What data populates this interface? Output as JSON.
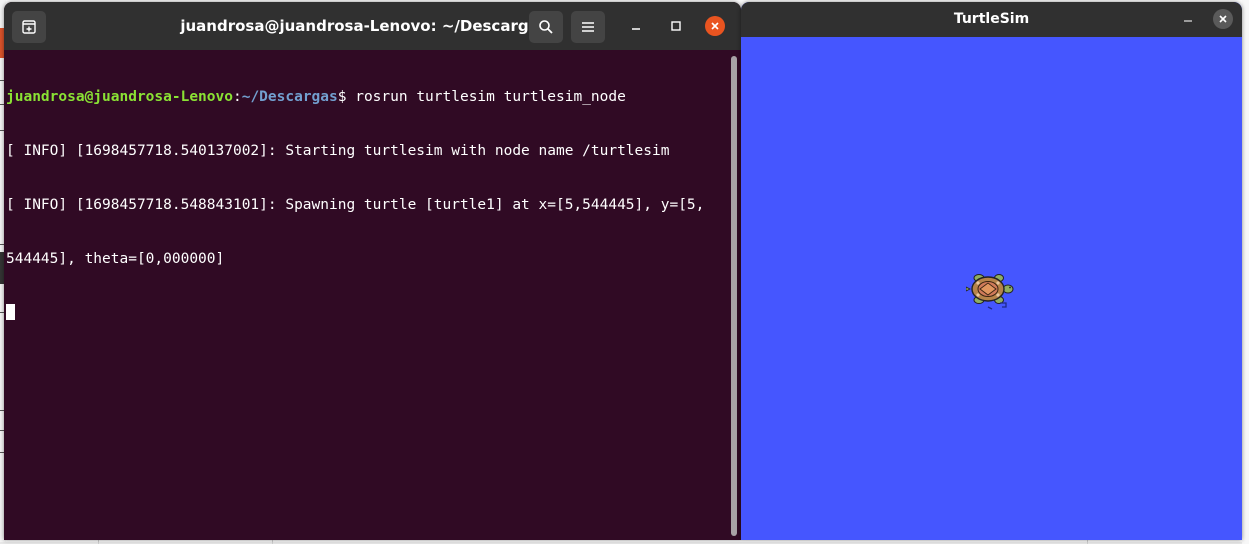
{
  "terminal": {
    "title": "juandrosa@juandrosa-Lenovo: ~/Descargas",
    "prompt_user": "juandrosa@juandrosa-Lenovo",
    "prompt_sep": ":",
    "prompt_path": "~/Descargas",
    "prompt_end": "$ ",
    "command": "rosrun turtlesim turtlesim_node",
    "output_lines": [
      "[ INFO] [1698457718.540137002]: Starting turtlesim with node name /turtlesim",
      "[ INFO] [1698457718.548843101]: Spawning turtle [turtle1] at x=[5,544445], y=[5,",
      "544445], theta=[0,000000]"
    ],
    "icons": {
      "new_tab": "new-tab-icon",
      "search": "search-icon",
      "menu": "hamburger-menu-icon",
      "minimize": "minimize-icon",
      "maximize": "maximize-icon",
      "close": "close-icon"
    },
    "colors": {
      "background": "#300a24",
      "header": "#303030",
      "prompt_user": "#8ae234",
      "prompt_path": "#729fcf",
      "close_button": "#e95420"
    }
  },
  "turtlesim": {
    "title": "TurtleSim",
    "icons": {
      "minimize": "minimize-icon",
      "close": "close-icon",
      "turtle": "turtle-icon"
    },
    "colors": {
      "canvas": "#4556ff",
      "header": "#303030"
    }
  }
}
